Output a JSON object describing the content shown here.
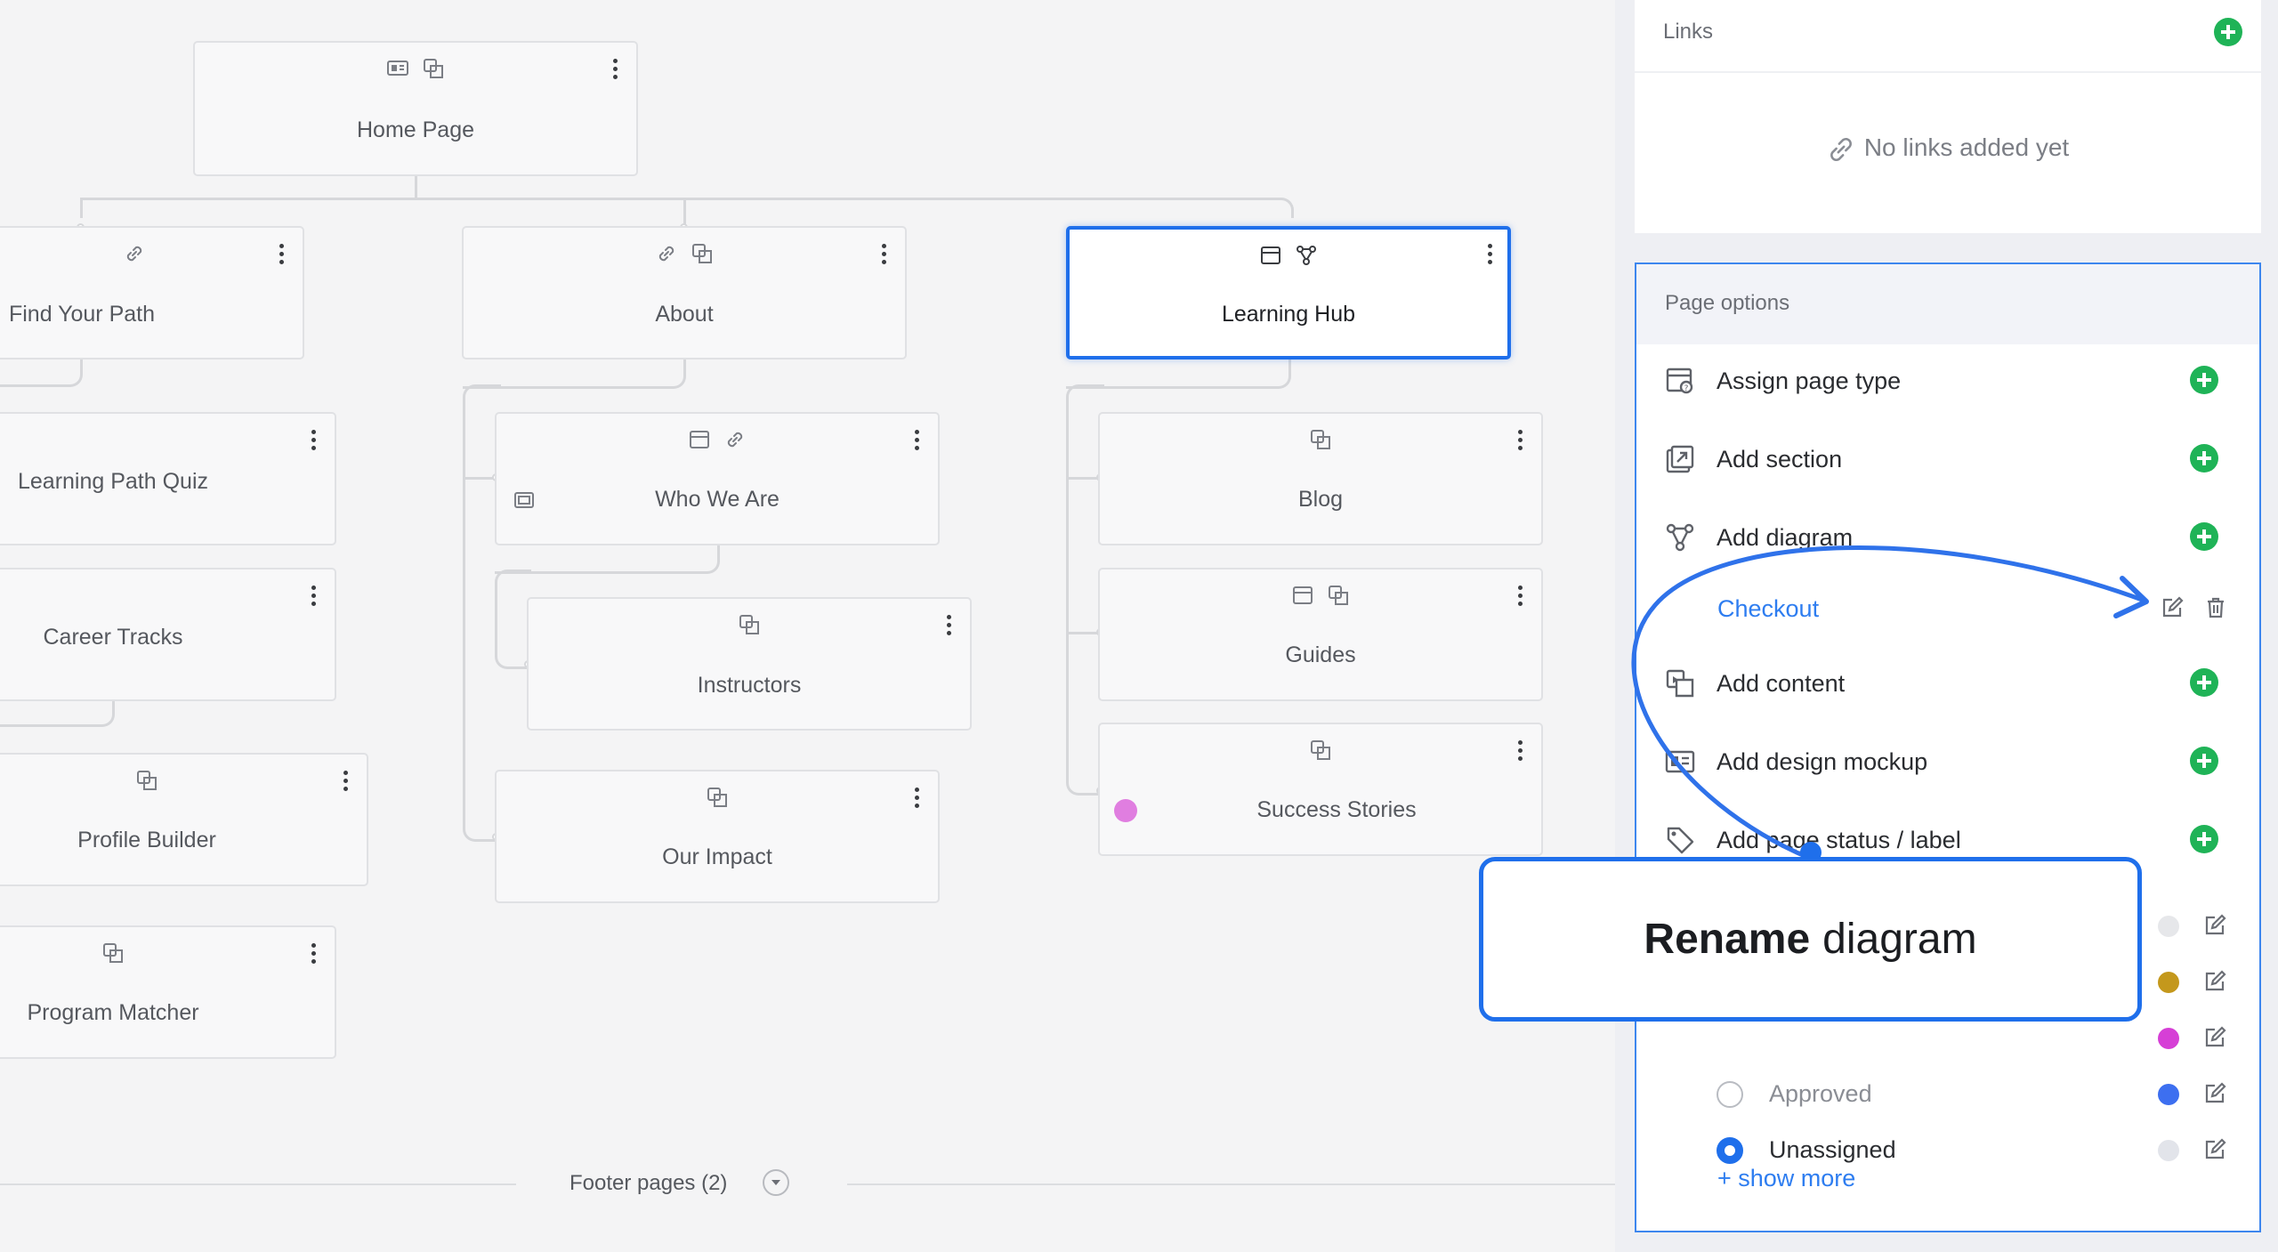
{
  "canvas": {
    "root": {
      "label": "Home Page"
    },
    "nodes": {
      "find_your_path": "Find Your Path",
      "about": "About",
      "learning_hub": "Learning Hub",
      "learning_path_quiz": "Learning Path Quiz",
      "career_tracks": "Career Tracks",
      "profile_builder": "Profile Builder",
      "program_matcher": "Program Matcher",
      "who_we_are": "Who We Are",
      "instructors": "Instructors",
      "our_impact": "Our Impact",
      "blog": "Blog",
      "guides": "Guides",
      "success_stories": "Success Stories"
    },
    "success_stories_dot_color": "#e07ee0",
    "footer": {
      "label": "Footer pages (2)"
    }
  },
  "panel": {
    "links": {
      "title": "Links",
      "empty_text": "No links added yet"
    },
    "page_options": {
      "title": "Page options",
      "items": {
        "assign_page_type": "Assign page type",
        "add_section": "Add section",
        "add_diagram": "Add diagram",
        "add_content": "Add content",
        "add_design_mockup": "Add design mockup",
        "add_page_status": "Add page status / label"
      },
      "diagram_link": "Checkout",
      "statuses": [
        {
          "label": "",
          "color": "#e6e7ea",
          "selected": false
        },
        {
          "label": "",
          "color": "#c4981c",
          "selected": false
        },
        {
          "label": "",
          "color": "#d63fd6",
          "selected": false
        },
        {
          "label": "Approved",
          "color": "#3d6ff0",
          "selected": false
        },
        {
          "label": "Unassigned",
          "color": "#e2e4ea",
          "selected": true
        }
      ],
      "show_more": "+ show more"
    }
  },
  "callout": {
    "bold": "Rename",
    "rest": "diagram"
  },
  "colors": {
    "accent": "#1f6feb",
    "plus_green": "#1fb357",
    "link_blue": "#2e7df0"
  }
}
